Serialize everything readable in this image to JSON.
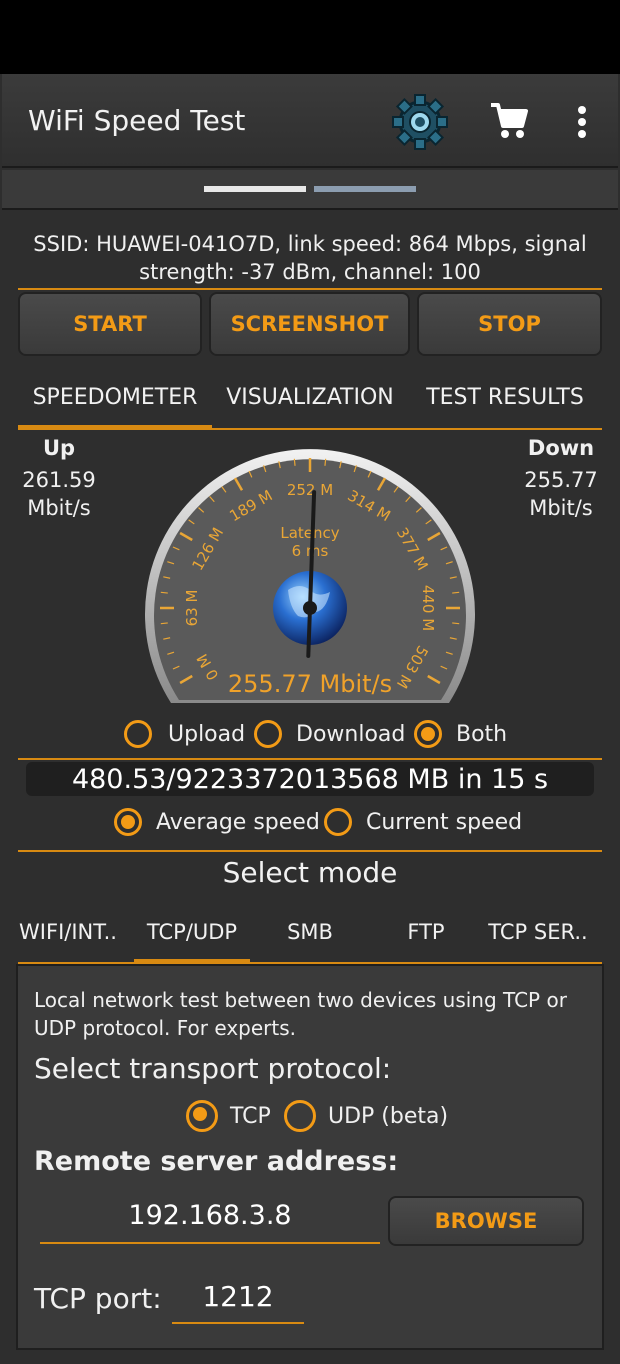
{
  "app": {
    "title": "WiFi Speed Test"
  },
  "header_icons": {
    "settings": "gear-icon",
    "store": "cart-icon",
    "menu": "more-vert-icon"
  },
  "ssid_info": "SSID: HUAWEI-041O7D, link speed: 864 Mbps, signal strength: -37 dBm, channel: 100",
  "buttons": {
    "start": "START",
    "screenshot": "SCREENSHOT",
    "stop": "STOP"
  },
  "tabs": [
    "SPEEDOMETER",
    "VISUALIZATION",
    "TEST RESULTS"
  ],
  "active_tab": "SPEEDOMETER",
  "up": {
    "label": "Up",
    "value": "261.59",
    "unit": "Mbit/s"
  },
  "down": {
    "label": "Down",
    "value": "255.77",
    "unit": "Mbit/s"
  },
  "gauge": {
    "ticks": [
      "0 M",
      "63 M",
      "126 M",
      "189 M",
      "252 M",
      "314 M",
      "377 M",
      "440 M",
      "503 M"
    ],
    "latency_label": "Latency",
    "latency_value": "6 ms",
    "reading": "255.77 Mbit/s",
    "max_mbit": 503,
    "needle_value_mbit": 255.77
  },
  "direction": {
    "upload": "Upload",
    "download": "Download",
    "both": "Both",
    "selected": "Both"
  },
  "transfer": "480.53/9223372013568 MB in 15 s",
  "speed_type": {
    "average": "Average speed",
    "current": "Current speed",
    "selected": "Average speed"
  },
  "mode": {
    "title": "Select mode",
    "tabs": [
      "WIFI/INT..",
      "TCP/UDP",
      "SMB",
      "FTP",
      "TCP SER.."
    ],
    "active": "TCP/UDP"
  },
  "tcp_panel": {
    "description": "Local network test between two devices using TCP or UDP protocol. For experts.",
    "transport_label": "Select transport protocol:",
    "tcp": "TCP",
    "udp": "UDP (beta)",
    "selected_protocol": "TCP",
    "remote_label": "Remote server address:",
    "remote_value": "192.168.3.8",
    "browse": "BROWSE",
    "port_label": "TCP port:",
    "port_value": "1212"
  }
}
